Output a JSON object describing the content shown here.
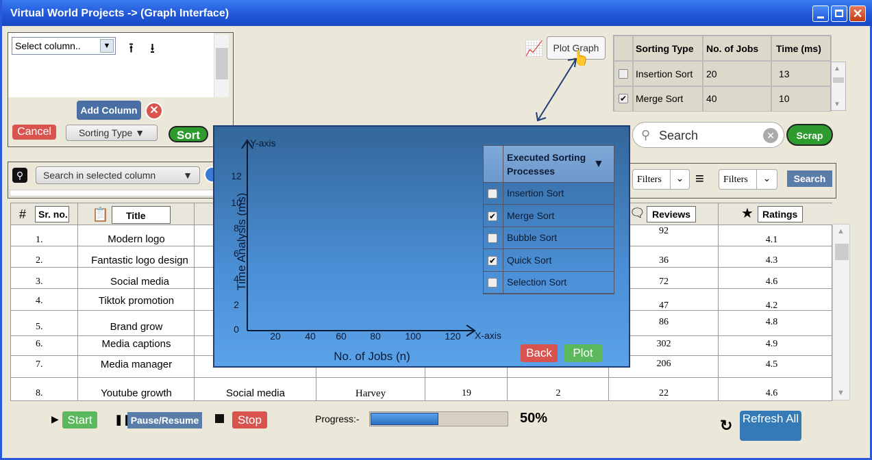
{
  "window": {
    "title": "Virtual World Projects -> (Graph Interface)"
  },
  "left_panel": {
    "column_select": "Select column..",
    "add_column": "Add Column",
    "cancel": "Cancel",
    "sorting_type": "Sorting Type",
    "sort": "Sort"
  },
  "search_column": {
    "label": "Search in selected column"
  },
  "plot_graph": {
    "label": "Plot Graph"
  },
  "sort_table": {
    "headers": [
      "Sorting Type",
      "No. of Jobs",
      "Time (ms)"
    ],
    "rows": [
      {
        "checked": false,
        "type": "Insertion Sort",
        "jobs": "20",
        "time": "13"
      },
      {
        "checked": true,
        "type": "Merge Sort",
        "jobs": "40",
        "time": "10"
      }
    ]
  },
  "search": {
    "placeholder": "Search",
    "scrap": "Scrap",
    "filter1": "Filters",
    "filter2": "Filters",
    "search_btn": "Search"
  },
  "main_table": {
    "headers": {
      "no": "#",
      "sr": "Sr. no.",
      "title": "Title",
      "reviews": "Reviews",
      "ratings": "Ratings"
    },
    "rows": [
      {
        "sr": "1.",
        "title": "Modern logo",
        "reviews": "92",
        "rating": "4.1"
      },
      {
        "sr": "2.",
        "title": "Fantastic logo design",
        "reviews": "36",
        "rating": "4.3"
      },
      {
        "sr": "3.",
        "title": "Social media",
        "reviews": "72",
        "rating": "4.6"
      },
      {
        "sr": "4.",
        "title": "Tiktok promotion",
        "reviews": "47",
        "rating": "4.2"
      },
      {
        "sr": "5.",
        "title": "Brand grow",
        "reviews": "86",
        "rating": "4.8"
      },
      {
        "sr": "6.",
        "title": "Media captions",
        "reviews": "302",
        "rating": "4.9"
      },
      {
        "sr": "7.",
        "title": "Media manager",
        "reviews": "206",
        "rating": "4.5"
      },
      {
        "sr": "8.",
        "title": "Youtube growth",
        "category": "Social media",
        "seller": "Harvey",
        "c4": "19",
        "c5": "2",
        "reviews": "22",
        "rating": "4.6"
      }
    ]
  },
  "modal": {
    "y_axis_label": "Y-axis",
    "x_axis_label": "X-axis",
    "y_title": "Time Analysis (ms)",
    "x_title": "No. of Jobs (n)",
    "y_ticks": [
      "0",
      "2",
      "4",
      "6",
      "8",
      "10",
      "12"
    ],
    "x_ticks": [
      "20",
      "40",
      "60",
      "80",
      "100",
      "120"
    ],
    "processes_header": "Executed Sorting Processes",
    "processes": [
      {
        "label": "Insertion Sort",
        "checked": false
      },
      {
        "label": "Merge Sort",
        "checked": true
      },
      {
        "label": "Bubble Sort",
        "checked": false
      },
      {
        "label": "Quick Sort",
        "checked": true
      },
      {
        "label": "Selection Sort",
        "checked": false
      }
    ],
    "back": "Back",
    "plot": "Plot"
  },
  "controls": {
    "start": "Start",
    "pause": "Pause/Resume",
    "stop": "Stop",
    "progress_label": "Progress:-",
    "progress_value": 50,
    "progress_text": "50%",
    "refresh": "Refresh All"
  }
}
